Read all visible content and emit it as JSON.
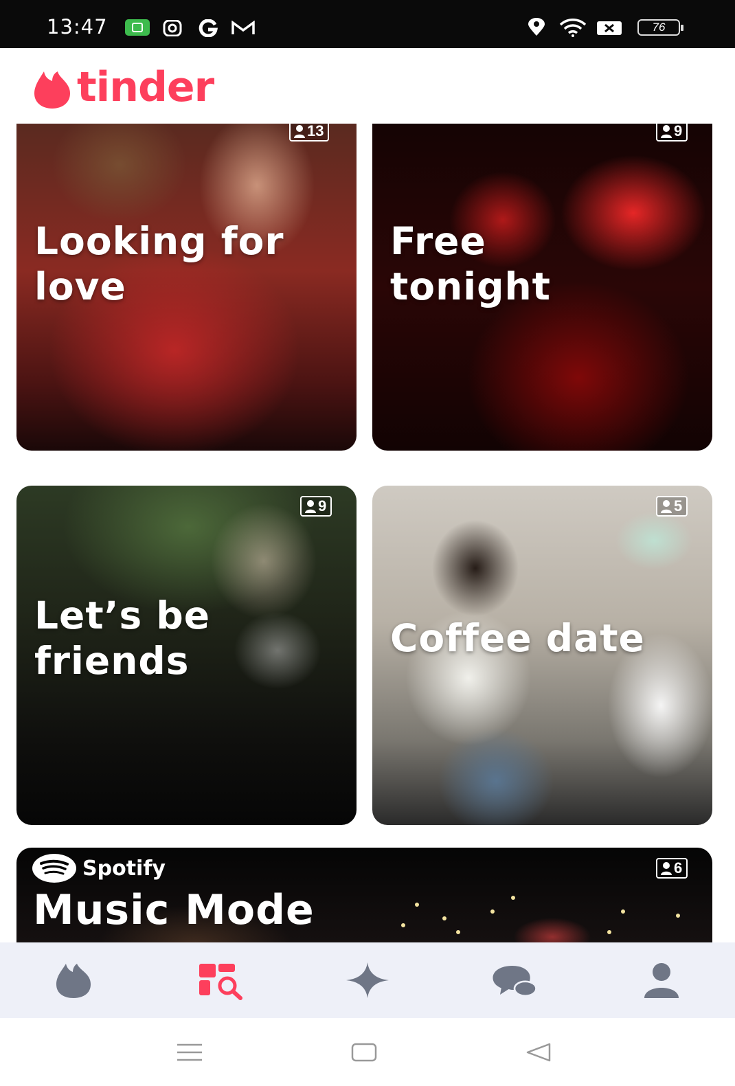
{
  "status_bar": {
    "time": "13:47",
    "battery": "76",
    "left_icons": [
      "wechat-icon",
      "instagram-icon",
      "google-icon",
      "gmail-icon"
    ],
    "right_icons": [
      "location-icon",
      "wifi-icon",
      "sim-icon",
      "battery-icon"
    ]
  },
  "header": {
    "brand": "tinder",
    "brand_color": "#fd3f5c"
  },
  "cards": [
    {
      "title_line1": "Looking for",
      "title_line2": "love",
      "count": "13"
    },
    {
      "title_line1": "Free",
      "title_line2": "tonight",
      "count": "9"
    },
    {
      "title_line1": "Let’s be",
      "title_line2": "friends",
      "count": "9"
    },
    {
      "title_line1": "Coffee date",
      "count": "5"
    }
  ],
  "music_card": {
    "partner": "Spotify",
    "title": "Music Mode",
    "count": "6"
  },
  "bottom_nav": {
    "items": [
      {
        "icon": "flame-icon",
        "active": false
      },
      {
        "icon": "explore-icon",
        "active": true
      },
      {
        "icon": "sparkle-icon",
        "active": false
      },
      {
        "icon": "chat-icon",
        "active": false
      },
      {
        "icon": "profile-icon",
        "active": false
      }
    ],
    "active_color": "#fd3f5c",
    "inactive_color": "#6f7686"
  },
  "system_nav": {
    "buttons": [
      "menu-icon",
      "home-icon",
      "back-icon"
    ]
  }
}
